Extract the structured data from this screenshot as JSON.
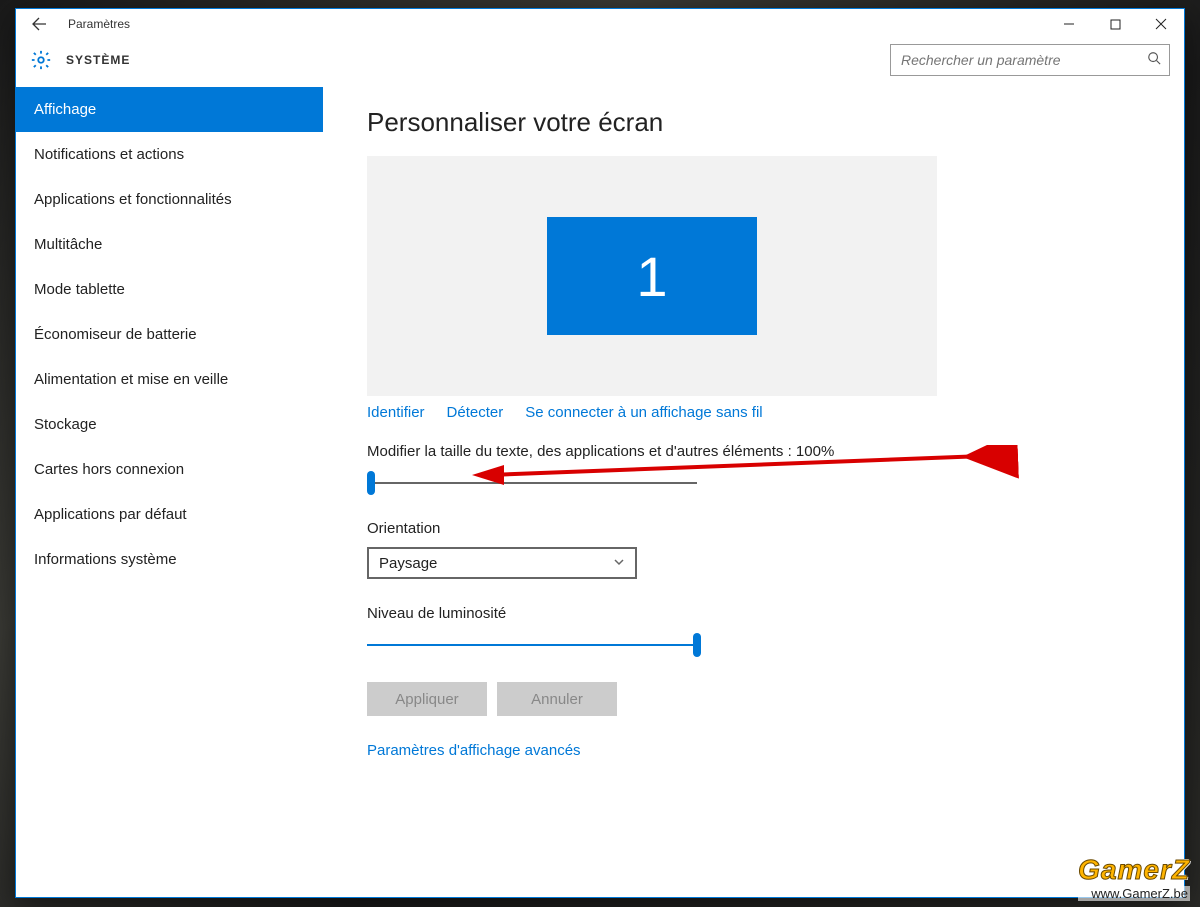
{
  "titlebar": {
    "app_name": "Paramètres"
  },
  "header": {
    "section": "SYSTÈME"
  },
  "search": {
    "placeholder": "Rechercher un paramètre"
  },
  "sidebar": {
    "items": [
      {
        "label": "Affichage",
        "active": true
      },
      {
        "label": "Notifications et actions"
      },
      {
        "label": "Applications et fonctionnalités"
      },
      {
        "label": "Multitâche"
      },
      {
        "label": "Mode tablette"
      },
      {
        "label": "Économiseur de batterie"
      },
      {
        "label": "Alimentation et mise en veille"
      },
      {
        "label": "Stockage"
      },
      {
        "label": "Cartes hors connexion"
      },
      {
        "label": "Applications par défaut"
      },
      {
        "label": "Informations système"
      }
    ]
  },
  "main": {
    "title": "Personnaliser votre écran",
    "monitor_number": "1",
    "links": {
      "identify": "Identifier",
      "detect": "Détecter",
      "wireless": "Se connecter à un affichage sans fil"
    },
    "scale_label": "Modifier la taille du texte, des applications et d'autres éléments : 100%",
    "scale_value_percent": 100,
    "orientation_label": "Orientation",
    "orientation_value": "Paysage",
    "brightness_label": "Niveau de luminosité",
    "brightness_percent": 100,
    "apply_label": "Appliquer",
    "cancel_label": "Annuler",
    "advanced_link": "Paramètres d'affichage avancés"
  },
  "watermark": {
    "line1": "GamerZ",
    "line2": "www.GamerZ.be"
  },
  "colors": {
    "accent": "#0078d7"
  }
}
